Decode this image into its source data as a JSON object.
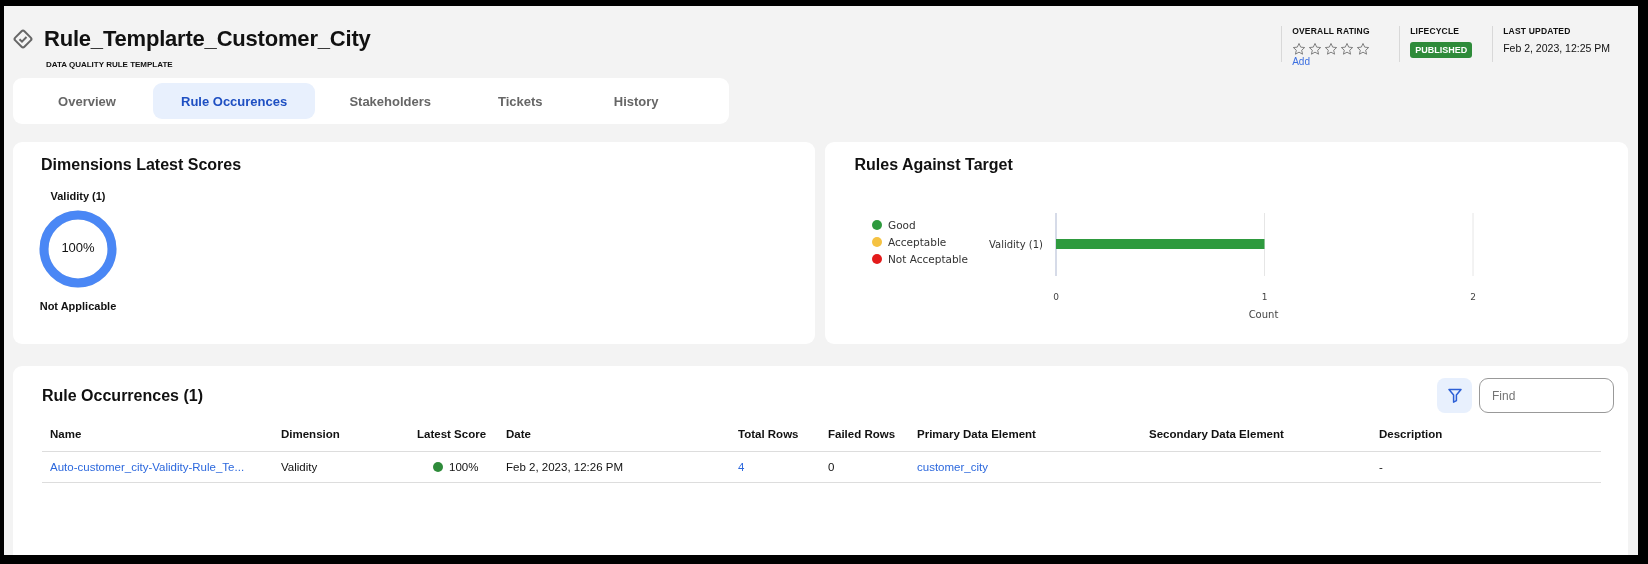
{
  "header": {
    "title": "Rule_Templarte_Customer_City",
    "subtitle": "DATA QUALITY RULE TEMPLATE"
  },
  "tabs": [
    {
      "label": "Overview",
      "selected": false
    },
    {
      "label": "Rule Occurences",
      "selected": true
    },
    {
      "label": "Stakeholders",
      "selected": false
    },
    {
      "label": "Tickets",
      "selected": false
    },
    {
      "label": "History",
      "selected": false
    }
  ],
  "meta": {
    "rating_label": "OVERALL RATING",
    "stars": 0,
    "add_link": "Add",
    "lifecycle_label": "LIFECYCLE",
    "lifecycle_status": "PUBLISHED",
    "updated_label": "LAST UPDATED",
    "updated_value": "Feb 2, 2023, 12:25 PM"
  },
  "dimensions_card": {
    "title": "Dimensions Latest Scores",
    "scores": [
      {
        "label": "Validity (1)",
        "level": 1,
        "value": "100%",
        "status": "Not Applicable"
      }
    ]
  },
  "target_card": {
    "title": "Rules Against Target",
    "chart_data": {
      "type": "bar",
      "orientation": "horizontal",
      "stacked": true,
      "xlabel": "Count",
      "categories": [
        "Validity (1)"
      ],
      "series": [
        {
          "name": "Good",
          "color": "#2e9a3e",
          "values": [
            1
          ]
        },
        {
          "name": "Acceptable",
          "color": "#f5c242",
          "values": [
            null
          ]
        },
        {
          "name": "Not Acceptable",
          "color": "#e31b1b",
          "values": [
            null
          ]
        }
      ],
      "xlim": [
        0,
        2
      ],
      "xticks": [
        0,
        1,
        2
      ]
    }
  },
  "occurrences": {
    "title": "Rule Occurrences (1)",
    "search": {
      "placeholder": "Find"
    },
    "columns": [
      "Name",
      "Dimension",
      "Latest Score",
      "Date",
      "Total Rows",
      "Failed Rows",
      "Primary Data Element",
      "Secondary Data Element",
      "Description"
    ],
    "rows": [
      {
        "name": "Auto-customer_city-Validity-Rule_Te...",
        "dimension": "Validity",
        "score": "100%",
        "color": "#2e8b3a",
        "date": "Feb 2, 2023, 12:26 PM",
        "total_rows": "4",
        "failed_rows": "0",
        "primary": "customer_city",
        "description": "-"
      }
    ]
  }
}
